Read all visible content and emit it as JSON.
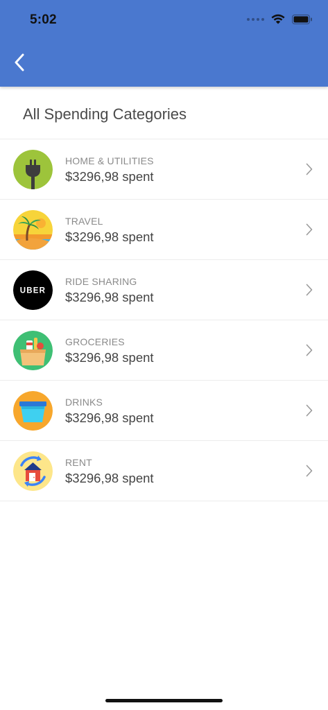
{
  "status_bar": {
    "time": "5:02"
  },
  "nav": {
    "back_icon": "chevron-left-icon"
  },
  "page": {
    "title": "All Spending Categories"
  },
  "categories": [
    {
      "label": "HOME & UTILITIES",
      "amount": "$3296,98 spent",
      "icon": "plug-icon"
    },
    {
      "label": "TRAVEL",
      "amount": "$3296,98 spent",
      "icon": "beach-icon"
    },
    {
      "label": "RIDE SHARING",
      "amount": "$3296,98 spent",
      "icon": "uber-logo-icon",
      "icon_text": "UBER"
    },
    {
      "label": "GROCERIES",
      "amount": "$3296,98 spent",
      "icon": "grocery-bag-icon"
    },
    {
      "label": "DRINKS",
      "amount": "$3296,98 spent",
      "icon": "drink-cup-icon"
    },
    {
      "label": "RENT",
      "amount": "$3296,98 spent",
      "icon": "house-icon"
    }
  ],
  "colors": {
    "header": "#4a78cf",
    "title": "#4a4a4a",
    "label": "#8a8a8a",
    "divider": "#ececec"
  }
}
